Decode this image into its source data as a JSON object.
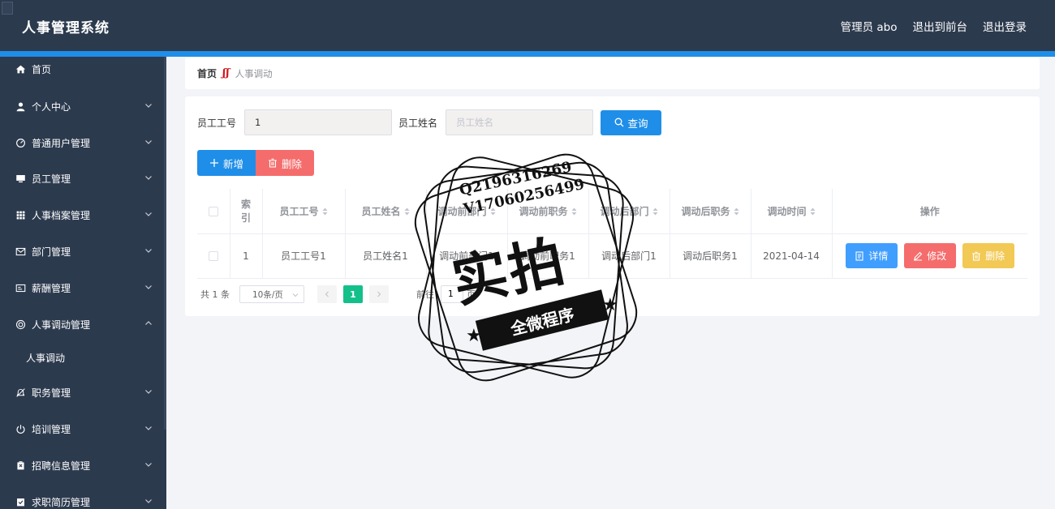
{
  "header": {
    "app_title": "人事管理系统",
    "nav": [
      "管理员 abo",
      "退出到前台",
      "退出登录"
    ]
  },
  "sidebar": {
    "items": [
      {
        "label": "首页",
        "icon": "home-icon",
        "has_chevron": false
      },
      {
        "label": "个人中心",
        "icon": "user-icon",
        "has_chevron": true
      },
      {
        "label": "普通用户管理",
        "icon": "dashboard-icon",
        "has_chevron": true
      },
      {
        "label": "员工管理",
        "icon": "monitor-icon",
        "has_chevron": true
      },
      {
        "label": "人事档案管理",
        "icon": "grid-icon",
        "has_chevron": true
      },
      {
        "label": "部门管理",
        "icon": "mail-icon",
        "has_chevron": true
      },
      {
        "label": "薪酬管理",
        "icon": "card-icon",
        "has_chevron": true
      },
      {
        "label": "人事调动管理",
        "icon": "cog-circle-icon",
        "has_chevron": true,
        "expanded": true
      },
      {
        "label": "职务管理",
        "icon": "bell-off-icon",
        "has_chevron": true
      },
      {
        "label": "培训管理",
        "icon": "power-icon",
        "has_chevron": true
      },
      {
        "label": "招聘信息管理",
        "icon": "trash-box-icon",
        "has_chevron": true
      },
      {
        "label": "求职简历管理",
        "icon": "check-box-icon",
        "has_chevron": true
      }
    ],
    "sub_item": "人事调动"
  },
  "breadcrumb": {
    "home": "首页",
    "separator": "ʃʃ",
    "current": "人事调动"
  },
  "search": {
    "emp_no_label": "员工工号",
    "emp_no_value": "1",
    "emp_name_label": "员工姓名",
    "emp_name_placeholder": "员工姓名",
    "query_label": "查询"
  },
  "actions": {
    "add_label": "新增",
    "delete_label": "删除"
  },
  "table": {
    "headers": [
      "索引",
      "员工工号",
      "员工姓名",
      "调动前部门",
      "调动前职务",
      "调动后部门",
      "调动后职务",
      "调动时间",
      "操作"
    ],
    "index_header_lines": [
      "索",
      "引"
    ],
    "rows": [
      {
        "index": "1",
        "emp_no": "员工工号1",
        "emp_name": "员工姓名1",
        "before_dept": "调动前部门1",
        "before_job": "调动前职务1",
        "after_dept": "调动后部门1",
        "after_job": "调动后职务1",
        "time": "2021-04-14",
        "op_detail": "详情",
        "op_edit": "修改",
        "op_delete": "删除"
      }
    ]
  },
  "pagination": {
    "total": "共 1 条",
    "page_size": "10条/页",
    "current_page": "1",
    "goto_label": "前往",
    "goto_value": "1",
    "page_suffix": "页"
  },
  "watermark": {
    "line1": "Q2196316269",
    "line2": "V17060256499",
    "big": "实拍",
    "ribbon": "全微程序"
  },
  "colors": {
    "header_bg": "#2c3a4e",
    "accent": "#1f8ee8",
    "danger": "#f56c6c",
    "warning": "#f2c955",
    "pager_active": "#13c08a"
  }
}
